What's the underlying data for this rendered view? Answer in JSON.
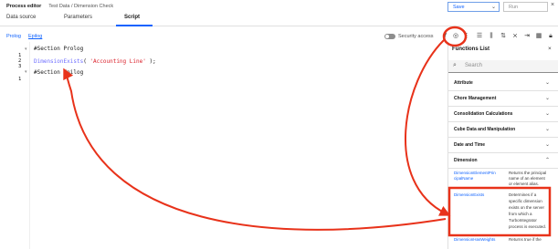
{
  "header": {
    "app_title": "Process editor",
    "breadcrumb": "Test Data / Dimension Check",
    "save_label": "Save",
    "run_label": "Run",
    "close_icon": "close-icon"
  },
  "tabs": [
    "Data source",
    "Parameters",
    "Script"
  ],
  "active_tab": "Script",
  "subtabs": [
    "Prolog",
    "Epilog"
  ],
  "toolbar": {
    "security_access_label": "Security access",
    "icons": [
      "function-icon",
      "help-icon",
      "list-icon",
      "columns-icon",
      "sort-icon",
      "crossed-icon",
      "wrap-icon",
      "lock-icon",
      "grid-icon"
    ]
  },
  "editor": {
    "line_numbers": [
      "1",
      "2",
      "3",
      "1"
    ],
    "lines": {
      "prolog_header": "#Section Prolog",
      "fn_name": "DimensionExists",
      "fn_open": "( ",
      "fn_arg": "'Accounting Line'",
      "fn_close": " );",
      "epilog_header": "#Section Epilog"
    }
  },
  "functions_panel": {
    "title": "Functions List",
    "search_placeholder": "Search",
    "categories": [
      "Attribute",
      "Chore Management",
      "Consolidation Calculations",
      "Cube Data and Manipulation",
      "Date and Time",
      "Dimension"
    ],
    "functions": [
      {
        "name_lines": [
          "DimensionElementPrin",
          "cipalName"
        ],
        "desc_lines": [
          "Returns the principal",
          "name of an element",
          "or element alias."
        ]
      },
      {
        "name_lines": [
          "DimensionExists"
        ],
        "desc_lines": [
          "Determines if a",
          "specific dimension",
          "exists on the server",
          "from which a",
          "TurboIntegrator",
          "process is executed."
        ]
      },
      {
        "name_lines": [
          "DimensionHasWeights"
        ],
        "desc_lines": [
          "Returns true if the"
        ]
      }
    ]
  },
  "colors": {
    "accent": "#0f62fe",
    "annotation": "#e8321a"
  }
}
